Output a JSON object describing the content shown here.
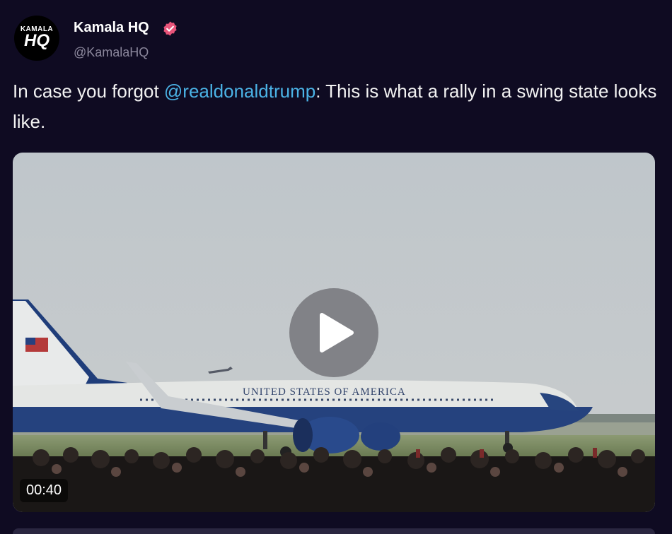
{
  "author": {
    "avatar_line1": "KAMALA",
    "avatar_line2": "HQ",
    "name": "Kamala HQ",
    "handle": "@KamalaHQ",
    "verified_icon": "verified-badge-icon",
    "verified_color": "#e8547a"
  },
  "tweet": {
    "text_before": "In case you forgot ",
    "mention": "@realdonaldtrump",
    "text_after": ": This is what a rally in a swing state looks like.",
    "mention_color": "#4bb3e6"
  },
  "media": {
    "type": "video",
    "duration": "00:40",
    "play_icon": "play-icon",
    "plane_text": "UNITED STATES OF AMERICA"
  }
}
